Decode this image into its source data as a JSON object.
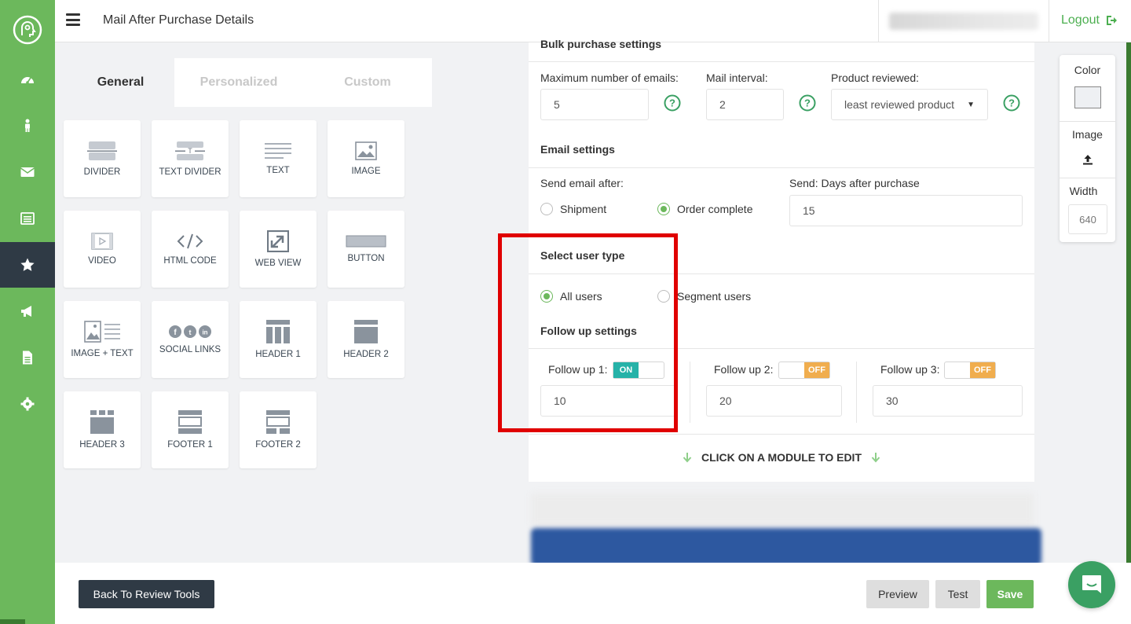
{
  "header": {
    "title": "Mail After Purchase Details",
    "logout_label": "Logout"
  },
  "sidebar": {
    "items": [
      {
        "icon": "dashboard-icon"
      },
      {
        "icon": "user-icon"
      },
      {
        "icon": "mail-icon"
      },
      {
        "icon": "list-icon"
      },
      {
        "icon": "star-icon",
        "active": true
      },
      {
        "icon": "megaphone-icon"
      },
      {
        "icon": "document-icon"
      },
      {
        "icon": "gear-icon"
      }
    ]
  },
  "module_panel": {
    "tabs": [
      "General",
      "Personalized",
      "Custom"
    ],
    "modules": [
      "DIVIDER",
      "TEXT DIVIDER",
      "TEXT",
      "IMAGE",
      "VIDEO",
      "HTML CODE",
      "WEB VIEW",
      "BUTTON",
      "IMAGE + TEXT",
      "SOCIAL LINKS",
      "HEADER 1",
      "HEADER 2",
      "HEADER 3",
      "FOOTER 1",
      "FOOTER 2"
    ]
  },
  "bulk": {
    "title": "Bulk purchase settings",
    "max_emails_label": "Maximum number of emails:",
    "max_emails_value": "5",
    "interval_label": "Mail interval:",
    "interval_value": "2",
    "product_label": "Product reviewed:",
    "product_value": "least reviewed product"
  },
  "email_settings": {
    "title": "Email settings",
    "send_after_label": "Send email after:",
    "option_shipment": "Shipment",
    "option_order_complete": "Order complete",
    "selected": "Order complete",
    "days_label": "Send: Days after purchase",
    "days_value": "15"
  },
  "user_type": {
    "title": "Select user type",
    "option_all": "All users",
    "option_segment": "Segment users",
    "selected": "All users"
  },
  "follow_up": {
    "title": "Follow up settings",
    "items": [
      {
        "label": "Follow up 1:",
        "state": "ON",
        "value": "10"
      },
      {
        "label": "Follow up 2:",
        "state": "OFF",
        "value": "20"
      },
      {
        "label": "Follow up 3:",
        "state": "OFF",
        "value": "30"
      }
    ]
  },
  "click_hint": "CLICK ON A MODULE TO EDIT",
  "props": {
    "color_label": "Color",
    "color_value": "#eef0f3",
    "image_label": "Image",
    "width_label": "Width",
    "width_value": "640"
  },
  "footer": {
    "back_label": "Back To Review Tools",
    "preview_label": "Preview",
    "test_label": "Test",
    "save_label": "Save"
  },
  "colors": {
    "brand_green": "#6cb85c",
    "sidebar_active": "#2f3a45",
    "toggle_on": "#26b2a8",
    "toggle_off": "#f0ad4e",
    "highlight": "#e00000"
  }
}
